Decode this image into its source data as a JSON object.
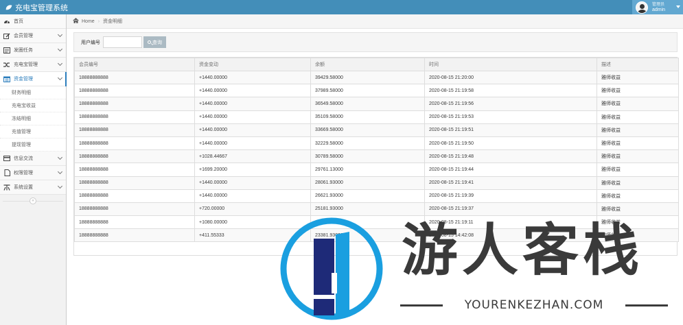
{
  "app": {
    "title": "充电宝管理系统"
  },
  "user": {
    "welcome": "管理员",
    "name": "admin"
  },
  "sidebar": {
    "items": [
      {
        "label": "首页",
        "icon": "dashboard-icon",
        "expandable": false
      },
      {
        "label": "会员管理",
        "icon": "edit-icon",
        "expandable": true
      },
      {
        "label": "发圈任务",
        "icon": "list-icon",
        "expandable": true
      },
      {
        "label": "充电宝管理",
        "icon": "shuffle-icon",
        "expandable": true
      },
      {
        "label": "资金管理",
        "icon": "calendar-icon",
        "expandable": true,
        "active": true
      }
    ],
    "subitems": [
      "财务明细",
      "充电宝收益",
      "冻结明细",
      "充值管理",
      "提现管理"
    ],
    "items_after": [
      {
        "label": "信息交流",
        "icon": "credit-card-icon",
        "expandable": true
      },
      {
        "label": "权限管理",
        "icon": "file-icon",
        "expandable": true
      },
      {
        "label": "系统设置",
        "icon": "tools-icon",
        "expandable": true
      }
    ],
    "collapse_glyph": "«"
  },
  "breadcrumb": {
    "home": "Home",
    "current": "资金明细"
  },
  "search": {
    "label": "用户编号",
    "value": "",
    "placeholder": "",
    "button": "查询"
  },
  "table": {
    "headers": [
      "会员编号",
      "资金变动",
      "余额",
      "时间",
      "描述"
    ],
    "rows": [
      [
        "18888888888",
        "+1440.00000",
        "39429.58000",
        "2020-08-15 21:20:00",
        "雅师收益"
      ],
      [
        "18888888888",
        "+1440.00000",
        "37989.58000",
        "2020-08-15 21:19:58",
        "雅师收益"
      ],
      [
        "18888888888",
        "+1440.00000",
        "36549.58000",
        "2020-08-15 21:19:56",
        "雅师收益"
      ],
      [
        "18888888888",
        "+1440.00000",
        "35109.58000",
        "2020-08-15 21:19:53",
        "雅师收益"
      ],
      [
        "18888888888",
        "+1440.00000",
        "33669.58000",
        "2020-08-15 21:19:51",
        "雅师收益"
      ],
      [
        "18888888888",
        "+1440.00000",
        "32229.58000",
        "2020-08-15 21:19:50",
        "雅师收益"
      ],
      [
        "18888888888",
        "+1028.44667",
        "30789.58000",
        "2020-08-15 21:19:48",
        "雅师收益"
      ],
      [
        "18888888888",
        "+1699.20000",
        "29761.13000",
        "2020-08-15 21:19:44",
        "雅师收益"
      ],
      [
        "18888888888",
        "+1440.00000",
        "28061.93000",
        "2020-08-15 21:19:41",
        "雅师收益"
      ],
      [
        "18888888888",
        "+1440.00000",
        "26621.93000",
        "2020-08-15 21:19:39",
        "雅师收益"
      ],
      [
        "18888888888",
        "+720.00000",
        "25181.93000",
        "2020-08-15 21:19:37",
        "雅师收益"
      ],
      [
        "18888888888",
        "+1080.00000",
        "24461.93000",
        "2020-08-15 21:19:11",
        "雅师收益"
      ],
      [
        "18888888888",
        "+411.55333",
        "23381.93000",
        "2020-08-15 14:42:08",
        "雅师收益"
      ]
    ]
  },
  "watermark": {
    "text": "游人客栈",
    "url": "YOURENKEZHAN.COM"
  },
  "colors": {
    "navbar": "#438eb9",
    "accent": "#2b7dbc",
    "watermark_blue": "#1a9fe0",
    "watermark_navy": "#1e2a78"
  }
}
